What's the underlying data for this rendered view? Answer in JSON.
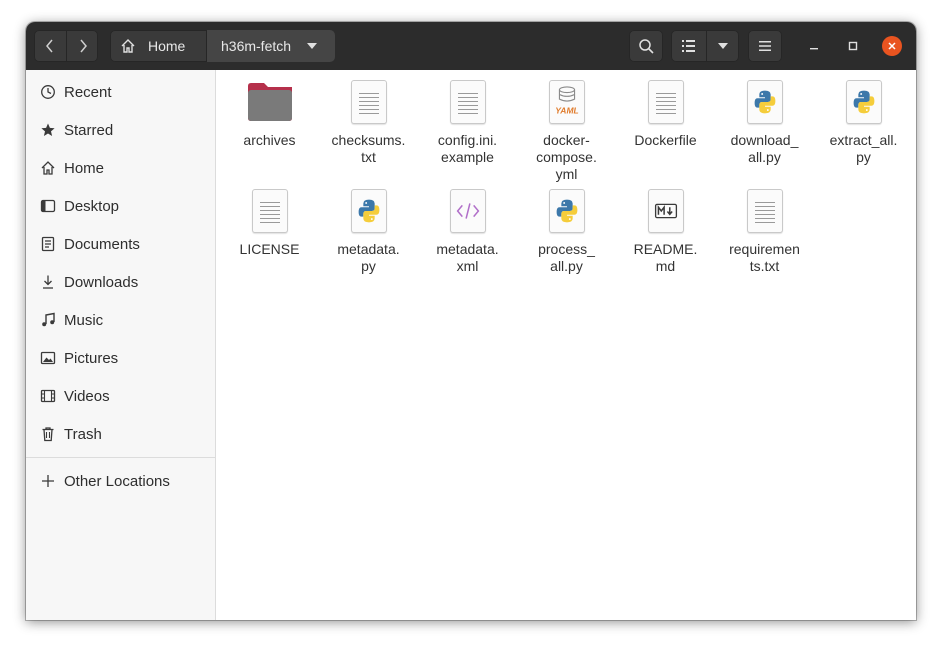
{
  "header": {
    "back_icon": "chevron-left-icon",
    "forward_icon": "chevron-right-icon",
    "breadcrumb": [
      {
        "label": "Home",
        "icon": "home-icon"
      },
      {
        "label": "h36m-fetch",
        "icon": "chevron-down-icon"
      }
    ],
    "search_icon": "search-icon",
    "view_icon": "list-view-icon",
    "view_options_icon": "chevron-down-icon",
    "menu_icon": "hamburger-icon",
    "minimize_icon": "minimize-icon",
    "maximize_icon": "maximize-icon",
    "close_icon": "close-icon",
    "close_color": "#e95420"
  },
  "sidebar": {
    "items": [
      {
        "label": "Recent",
        "icon": "clock-icon"
      },
      {
        "label": "Starred",
        "icon": "star-icon"
      },
      {
        "label": "Home",
        "icon": "home-icon"
      },
      {
        "label": "Desktop",
        "icon": "desktop-icon"
      },
      {
        "label": "Documents",
        "icon": "document-icon"
      },
      {
        "label": "Downloads",
        "icon": "download-icon"
      },
      {
        "label": "Music",
        "icon": "music-icon"
      },
      {
        "label": "Pictures",
        "icon": "picture-icon"
      },
      {
        "label": "Videos",
        "icon": "video-icon"
      },
      {
        "label": "Trash",
        "icon": "trash-icon"
      }
    ],
    "other": {
      "label": "Other Locations",
      "icon": "plus-icon"
    }
  },
  "files": [
    {
      "name": "archives",
      "type": "folder"
    },
    {
      "name": "checksums.\ntxt",
      "type": "text"
    },
    {
      "name": "config.ini.\nexample",
      "type": "text"
    },
    {
      "name": "docker-\ncompose.\nyml",
      "type": "yaml"
    },
    {
      "name": "Dockerfile",
      "type": "text"
    },
    {
      "name": "download_\nall.py",
      "type": "python"
    },
    {
      "name": "extract_all.\npy",
      "type": "python"
    },
    {
      "name": "LICENSE",
      "type": "text"
    },
    {
      "name": "metadata.\npy",
      "type": "python"
    },
    {
      "name": "metadata.\nxml",
      "type": "xml"
    },
    {
      "name": "process_\nall.py",
      "type": "python"
    },
    {
      "name": "README.\nmd",
      "type": "markdown"
    },
    {
      "name": "requiremen\nts.txt",
      "type": "text"
    }
  ],
  "colors": {
    "folder": "#7a7a7a",
    "folder_tab": "#b5304b",
    "python_blue": "#3c78aa",
    "python_yellow": "#f5cd3b",
    "xml": "#b16fc9",
    "yaml": "#e07b2c"
  }
}
